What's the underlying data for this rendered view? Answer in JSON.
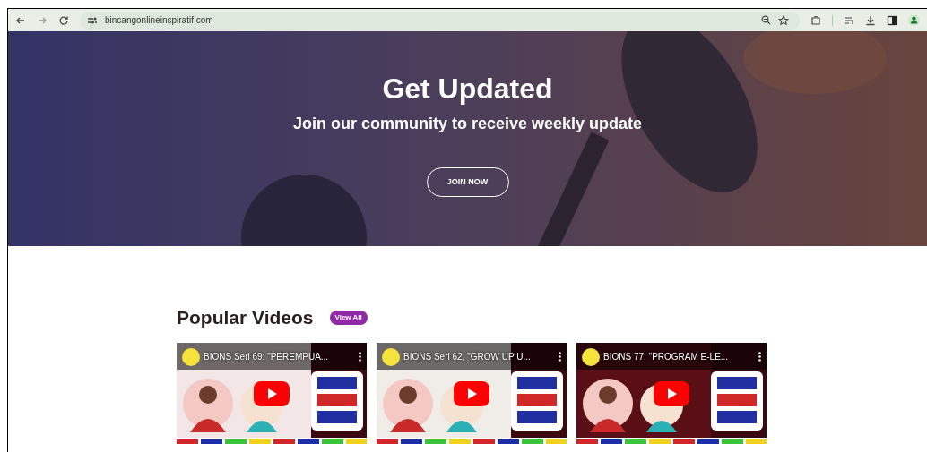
{
  "browser": {
    "url": "bincangonlineinspiratif.com"
  },
  "hero": {
    "title": "Get Updated",
    "subtitle": "Join our community to receive weekly update",
    "button": "JOIN NOW"
  },
  "popular": {
    "heading": "Popular Videos",
    "view_all": "View All",
    "videos": [
      {
        "title": "BIONS Seri 69: \"PEREMPUA..."
      },
      {
        "title": "BIONS Seri 62, \"GROW UP U..."
      },
      {
        "title": "BIONS 77, \"PROGRAM E-LE..."
      }
    ]
  }
}
